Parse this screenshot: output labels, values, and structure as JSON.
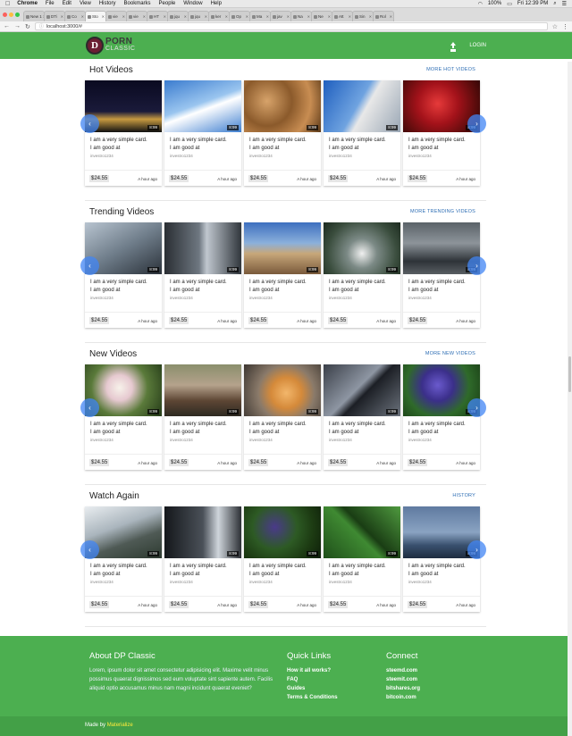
{
  "menubar": {
    "apple": "",
    "items": [
      "Chrome",
      "File",
      "Edit",
      "View",
      "History",
      "Bookmarks",
      "People",
      "Window",
      "Help"
    ],
    "battery": "100%",
    "clock": "Fri 12:39 PM"
  },
  "tabs": [
    "New 1",
    "DTi",
    "Co",
    "Sto",
    "vie",
    "vie",
    "HT",
    "jqu",
    "jqu",
    "ker",
    "Op",
    "Ma",
    "jav",
    "Na",
    "Ne",
    "Att",
    "Sin",
    "Rol"
  ],
  "address": {
    "url": "localhost:3000/#"
  },
  "site": {
    "logo_mark": "D",
    "logo_top": "PORN",
    "logo_bottom": "CLASSIC",
    "login": "LOGIN"
  },
  "card_defaults": {
    "desc_line1": "I am a very simple card.",
    "desc_line2": "I am good at",
    "user": "investro1234",
    "price": "$24.55",
    "ago": "A hour ago",
    "duration": "8:99"
  },
  "sections": [
    {
      "title": "Hot Videos",
      "link": "MORE HOT VIDEOS"
    },
    {
      "title": "Trending Videos",
      "link": "MORE TRENDING VIDEOS"
    },
    {
      "title": "New Videos",
      "link": "MORE NEW VIDEOS"
    },
    {
      "title": "Watch Again",
      "link": "HISTORY"
    }
  ],
  "footer": {
    "about_title": "About DP Classic",
    "about_text": "Lorem, ipsum dolor sit amet consectetur adipisicing elit. Maxime velit minus possimus quaerat dignissimos sed eum voluptate sint sapiente autem. Facilis aliquid optio accusamus minus nam magni incidunt quaerat eveniet?",
    "quick_title": "Quick Links",
    "quick_links": [
      "How it all works?",
      "FAQ",
      "Guides",
      "Terms & Conditions"
    ],
    "connect_title": "Connect",
    "connect_links": [
      "steemd.com",
      "steemit.com",
      "bitshares.org",
      "bitcoin.com"
    ],
    "made_by": "Made by ",
    "made_with": "Materialize"
  }
}
